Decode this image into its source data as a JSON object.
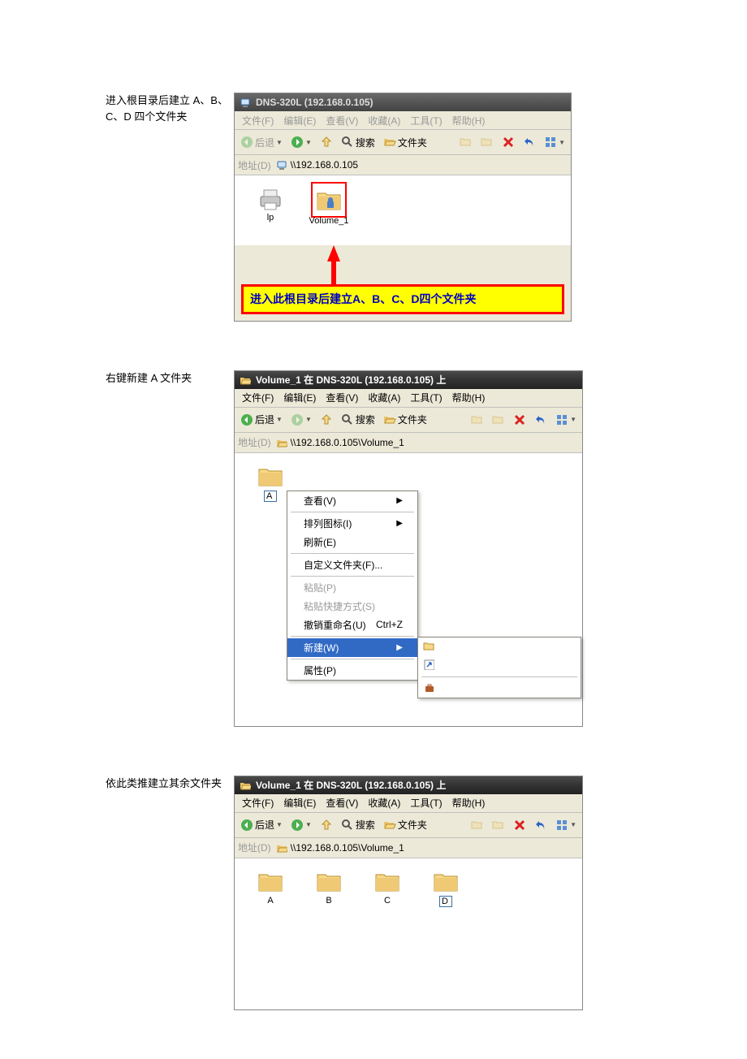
{
  "step1": {
    "caption": "进入根目录后建立 A、B、C、D 四个文件夹",
    "title": "DNS-320L (192.168.0.105)",
    "menu": {
      "file": "文件(F)",
      "edit": "编辑(E)",
      "view": "查看(V)",
      "fav": "收藏(A)",
      "tools": "工具(T)",
      "help": "帮助(H)"
    },
    "tb": {
      "back": "后退",
      "search": "搜索",
      "folders": "文件夹"
    },
    "addr_label": "地址(D)",
    "address": "\\\\192.168.0.105",
    "items": [
      {
        "name": "lp"
      },
      {
        "name": "Volume_1"
      }
    ],
    "callout": "进入此根目录后建立A、B、C、D四个文件夹"
  },
  "step2": {
    "caption": "右键新建 A 文件夹",
    "title": "Volume_1 在 DNS-320L (192.168.0.105) 上",
    "menu": {
      "file": "文件(F)",
      "edit": "编辑(E)",
      "view": "查看(V)",
      "fav": "收藏(A)",
      "tools": "工具(T)",
      "help": "帮助(H)"
    },
    "tb": {
      "back": "后退",
      "search": "搜索",
      "folders": "文件夹"
    },
    "addr_label": "地址(D)",
    "address": "\\\\192.168.0.105\\Volume_1",
    "new_folder_label": "A",
    "ctx": {
      "view": "查看(V)",
      "arrange": "排列图标(I)",
      "refresh": "刷新(E)",
      "customize": "自定义文件夹(F)...",
      "paste": "粘贴(P)",
      "paste_shortcut": "粘贴快捷方式(S)",
      "undo_rename": "撤销重命名(U)",
      "undo_shortcut": "Ctrl+Z",
      "new": "新建(W)",
      "properties": "属性(P)"
    },
    "sub": {
      "folder": "文件夹(F)",
      "shortcut": "快捷方式(S)",
      "briefcase": "公文包"
    }
  },
  "step3": {
    "caption": "依此类推建立其余文件夹",
    "title": "Volume_1 在 DNS-320L (192.168.0.105) 上",
    "menu": {
      "file": "文件(F)",
      "edit": "编辑(E)",
      "view": "查看(V)",
      "fav": "收藏(A)",
      "tools": "工具(T)",
      "help": "帮助(H)"
    },
    "tb": {
      "back": "后退",
      "search": "搜索",
      "folders": "文件夹"
    },
    "addr_label": "地址(D)",
    "address": "\\\\192.168.0.105\\Volume_1",
    "folders": [
      "A",
      "B",
      "C",
      "D"
    ]
  }
}
